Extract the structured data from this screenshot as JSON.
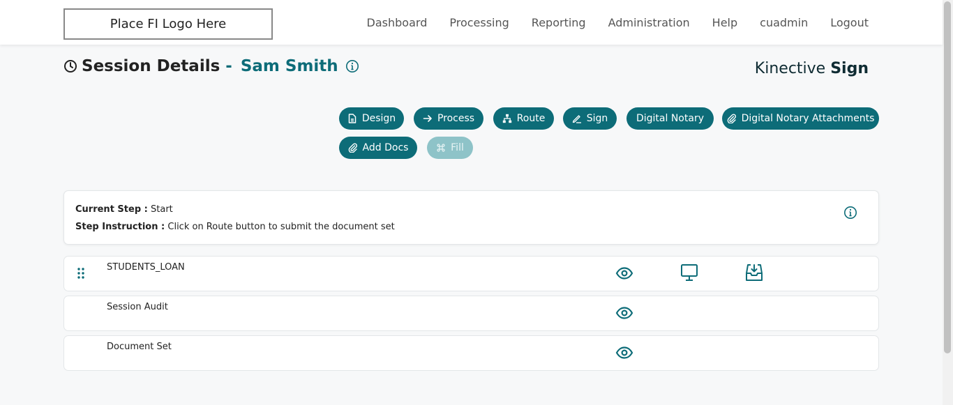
{
  "header": {
    "logo_text": "Place FI Logo Here",
    "nav": [
      "Dashboard",
      "Processing",
      "Reporting",
      "Administration",
      "Help",
      "cuadmin",
      "Logout"
    ]
  },
  "page": {
    "title": "Session Details",
    "dash": "-",
    "customer_name": "Sam Smith",
    "brand_light": "Kinective",
    "brand_bold": "Sign"
  },
  "actions": [
    {
      "label": "Design",
      "icon": "document-icon",
      "enabled": true
    },
    {
      "label": "Process",
      "icon": "arrow-right-icon",
      "enabled": true
    },
    {
      "label": "Route",
      "icon": "hierarchy-icon",
      "enabled": true
    },
    {
      "label": "Sign",
      "icon": "pen-icon",
      "enabled": true
    },
    {
      "label": "Digital Notary",
      "icon": "",
      "enabled": true
    },
    {
      "label": "Digital Notary Attachments",
      "icon": "paperclip-icon",
      "enabled": true
    },
    {
      "label": "Add Docs",
      "icon": "paperclip-icon",
      "enabled": true
    },
    {
      "label": "Fill",
      "icon": "command-icon",
      "enabled": false
    }
  ],
  "step": {
    "current_label": "Current Step :",
    "current_value": "Start",
    "instruction_label": "Step Instruction :",
    "instruction_value": "Click on Route button to submit the document set"
  },
  "documents": [
    {
      "name": "STUDENTS_LOAN",
      "icons": [
        "eye-icon",
        "monitor-icon",
        "inbox-download-icon"
      ],
      "draggable": true
    },
    {
      "name": "Session Audit",
      "icons": [
        "eye-icon"
      ],
      "draggable": false
    },
    {
      "name": "Document Set",
      "icons": [
        "eye-icon"
      ],
      "draggable": false
    }
  ],
  "colors": {
    "accent": "#0d6c78",
    "accent_disabled": "#8ec3c8",
    "background": "#f7f8f9"
  }
}
